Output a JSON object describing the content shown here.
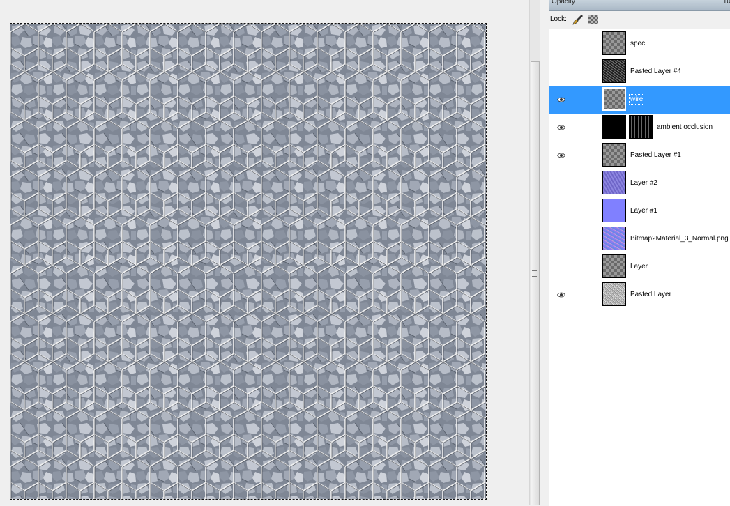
{
  "panel": {
    "opacity_label": "Opacity",
    "opacity_value": "10",
    "lock_label": "Lock:"
  },
  "icons": {
    "eye": "eye-icon",
    "lock_pixels": "paintbrush-icon",
    "lock_alpha": "checkerboard-icon"
  },
  "colors": {
    "selection": "#3399ff",
    "panel_bg": "#f0f0f0",
    "list_bg": "#ffffff"
  },
  "layers": [
    {
      "name": "spec",
      "visible": false,
      "selected": false,
      "thumb": "checker"
    },
    {
      "name": "Pasted Layer #4",
      "visible": false,
      "selected": false,
      "thumb": "noise"
    },
    {
      "name": "wire",
      "visible": true,
      "selected": true,
      "thumb": "checker"
    },
    {
      "name": "ambient occlusion",
      "visible": true,
      "selected": false,
      "thumb": "black",
      "mask": "stripes"
    },
    {
      "name": "Pasted Layer #1",
      "visible": true,
      "selected": false,
      "thumb": "checker"
    },
    {
      "name": "Layer #2",
      "visible": false,
      "selected": false,
      "thumb": "purple"
    },
    {
      "name": "Layer #1",
      "visible": false,
      "selected": false,
      "thumb": "blue"
    },
    {
      "name": "Bitmap2Material_3_Normal.png",
      "visible": false,
      "selected": false,
      "thumb": "normal"
    },
    {
      "name": "Layer",
      "visible": false,
      "selected": false,
      "thumb": "checker"
    },
    {
      "name": "Pasted Layer",
      "visible": true,
      "selected": false,
      "thumb": "pasted"
    }
  ]
}
